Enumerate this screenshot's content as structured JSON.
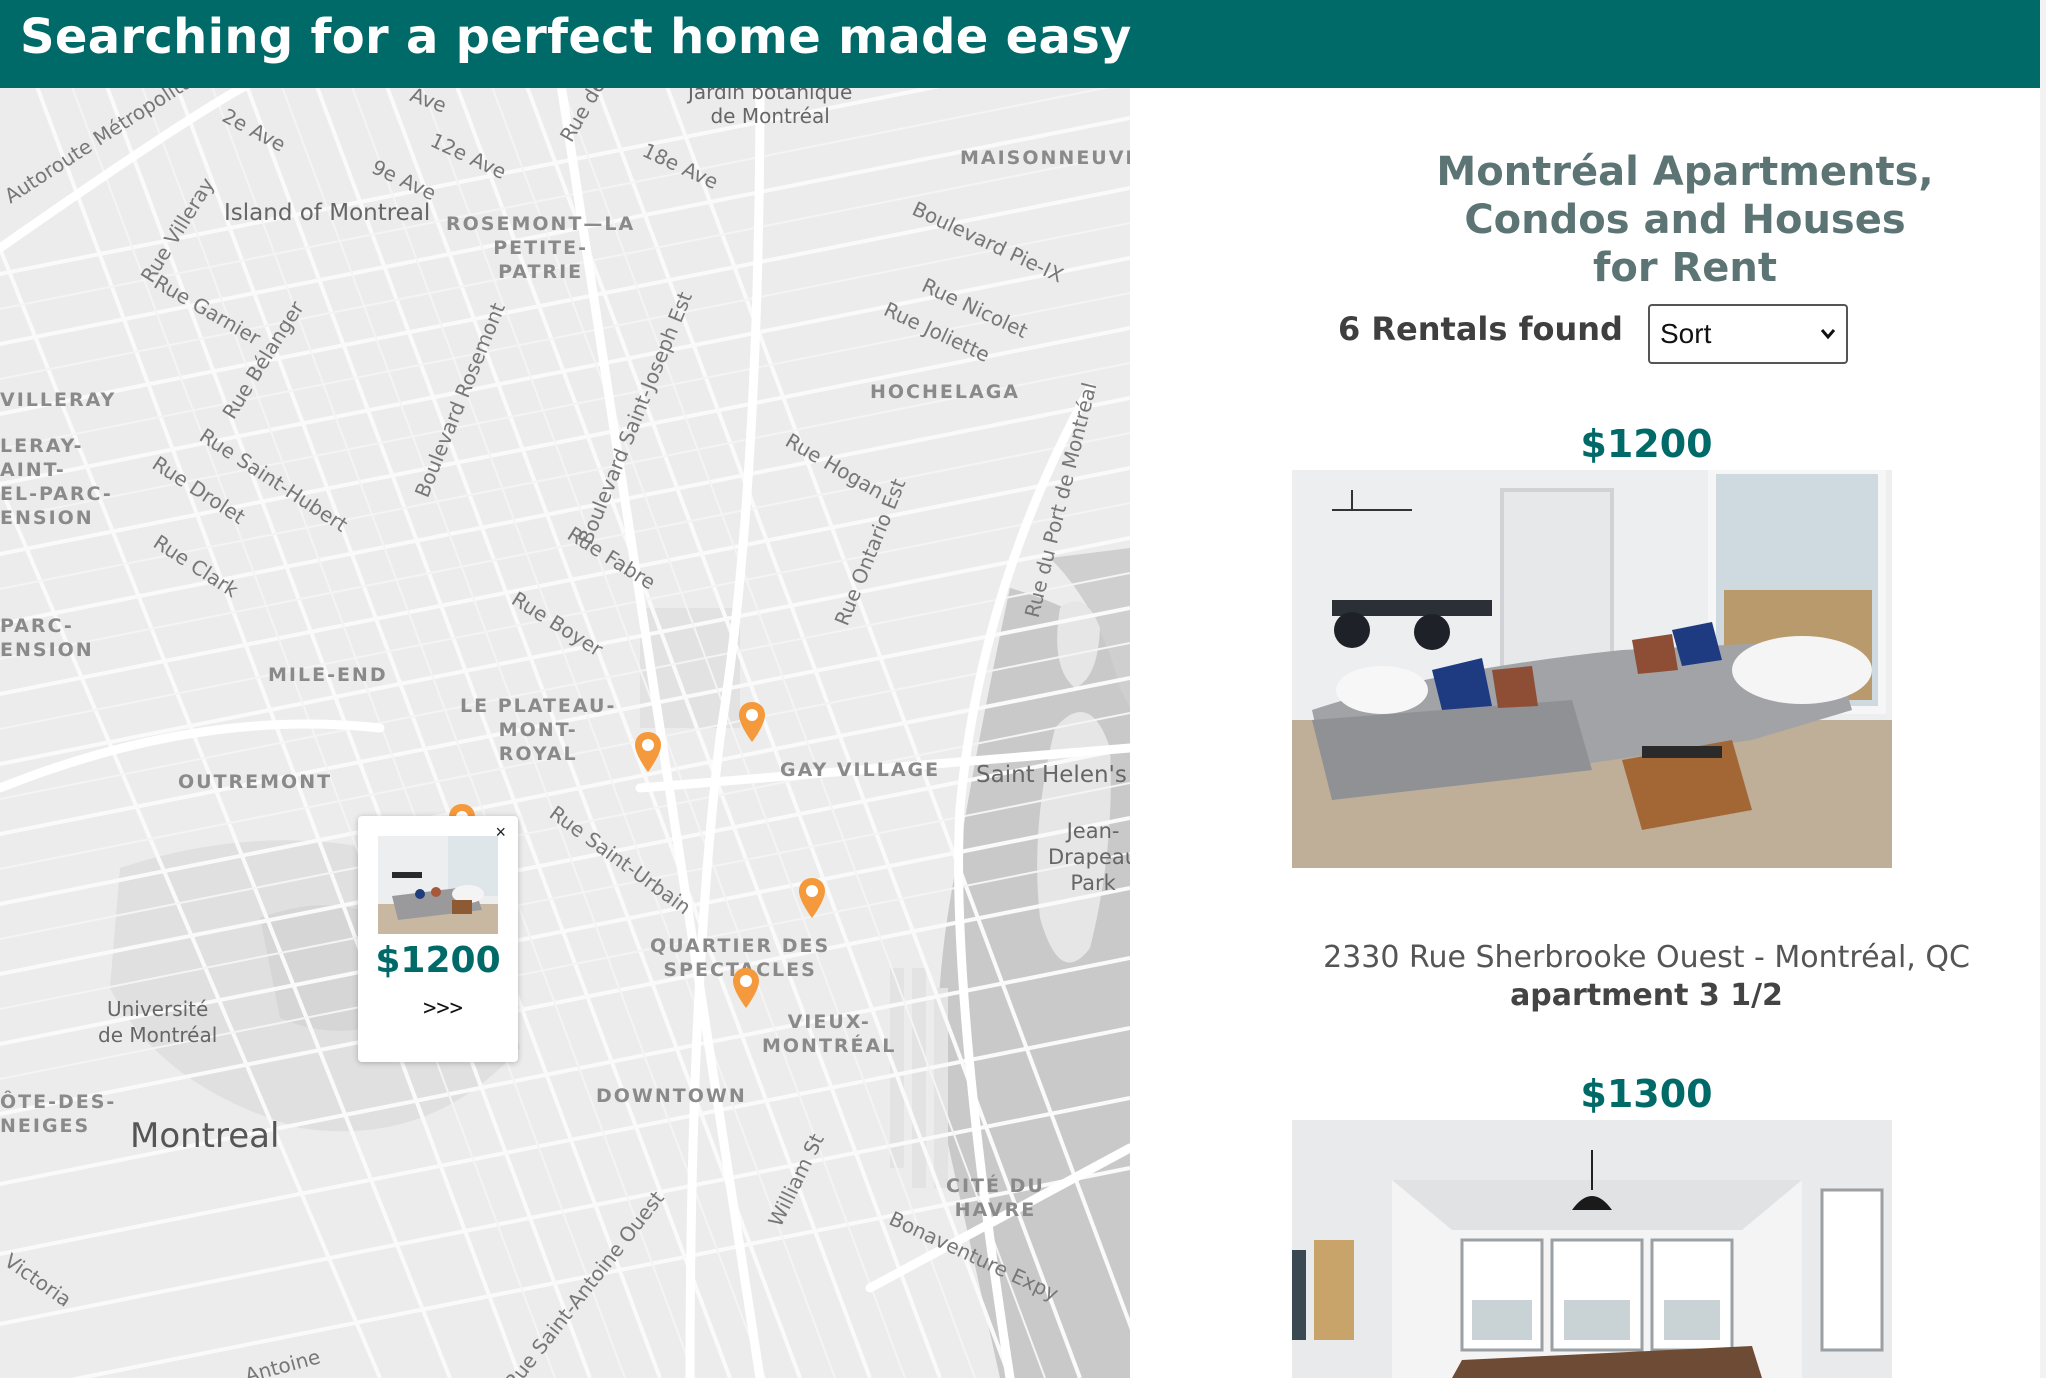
{
  "header": {
    "title": "Searching for a perfect home made easy"
  },
  "map": {
    "districts": [
      "MAISONNEUVE",
      "ROSEMONT—LA\nPETITE-\nPATRIE",
      "HOCHELAGA",
      "VILLERAY",
      "LERAY-\nAINT-\nEL-PARC-\nENSION",
      "PARC-\nENSION",
      "MILE-END",
      "LE PLATEAU-\nMONT-\nROYAL",
      "OUTREMONT",
      "GAY VILLAGE",
      "QUARTIER DES\nSPECTACLES",
      "VIEUX-\nMONTRÉAL",
      "DOWNTOWN",
      "ÔTE-DES-\nNEIGES",
      "CITÉ DU\nHAVRE"
    ],
    "streets": [
      "Autoroute Métropolitaine",
      "2e Ave",
      "9e Ave",
      "12e Ave",
      "18e Ave",
      "Rue de",
      "Rue Villeray",
      "Rue Garnier",
      "Rue Bélanger",
      "Boulevard Rosemont",
      "Boulevard Saint-Joseph Est",
      "Boulevard Pie-IX",
      "Rue Nicolet",
      "Rue Joliette",
      "Rue Saint-Hubert",
      "Rue Drolet",
      "Rue Clark",
      "Rue Hogan",
      "Rue Fabre",
      "Rue Boyer",
      "Rue Ontario Est",
      "Rue du Port de Montréal",
      "Rue Saint-Urbain",
      "William St",
      "Rue Saint-Antoine Ouest",
      "Bonaventure Expy",
      "Victoria",
      "Antoine",
      "Ave"
    ],
    "places": [
      "Jardin botanique\nde Montréal",
      "Island of Montreal",
      "Saint Helen's",
      "Jean-\nDrapeau\nPark",
      "Université\nde Montréal"
    ],
    "city": "Montreal",
    "pin_color": "#f59a3c",
    "popup": {
      "close": "×",
      "price": "$1200",
      "more": ">>>"
    }
  },
  "panel": {
    "title": "Montréal Apartments, Condos and Houses for Rent",
    "count": "6 Rentals found",
    "sort": {
      "selected": "Sort"
    },
    "listings": [
      {
        "price": "$1200",
        "address": "2330 Rue Sherbrooke Ouest - Montréal, QC",
        "type": "apartment 3 1/2"
      },
      {
        "price": "$1300"
      }
    ]
  },
  "colors": {
    "brand": "#006a68",
    "title_gray": "#5c7474",
    "pin": "#f59a3c"
  }
}
